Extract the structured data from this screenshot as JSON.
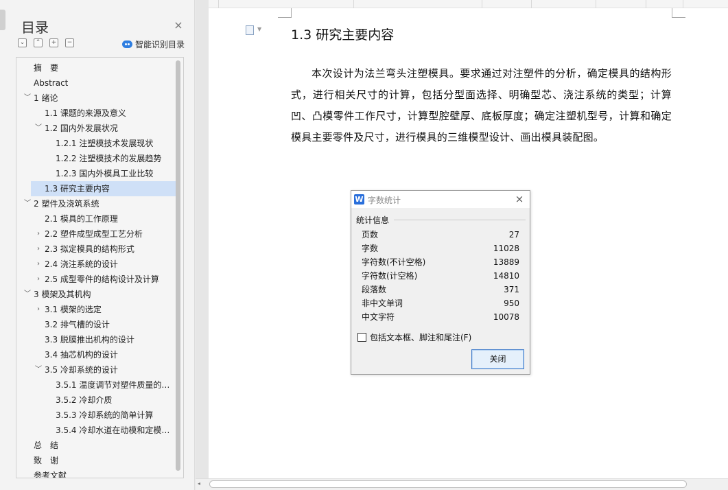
{
  "toc_panel": {
    "title": "目录",
    "close_glyph": "×",
    "tools": [
      "⌄",
      "⌃",
      "+",
      "−"
    ],
    "smart_identify_label": "智能识别目录",
    "items": [
      {
        "label": "摘　要",
        "level": 1,
        "caret": ""
      },
      {
        "label": "Abstract",
        "level": 1,
        "caret": ""
      },
      {
        "label": "1 绪论",
        "level": 1,
        "caret": "expanded"
      },
      {
        "label": "1.1 课题的来源及意义",
        "level": 2,
        "caret": ""
      },
      {
        "label": "1.2 国内外发展状况",
        "level": 2,
        "caret": "expanded"
      },
      {
        "label": "1.2.1 注塑模技术发展现状",
        "level": 3,
        "caret": ""
      },
      {
        "label": "1.2.2 注塑模技术的发展趋势",
        "level": 3,
        "caret": ""
      },
      {
        "label": "1.2.3 国内外模具工业比较",
        "level": 3,
        "caret": ""
      },
      {
        "label": "1.3 研究主要内容",
        "level": 2,
        "caret": "",
        "selected": true
      },
      {
        "label": "2 塑件及浇筑系统",
        "level": 1,
        "caret": "expanded"
      },
      {
        "label": "2.1 模具的工作原理",
        "level": 2,
        "caret": ""
      },
      {
        "label": "2.2 塑件成型成型工艺分析",
        "level": 2,
        "caret": "collapsed"
      },
      {
        "label": "2.3 拟定模具的结构形式",
        "level": 2,
        "caret": "collapsed"
      },
      {
        "label": "2.4 浇注系统的设计",
        "level": 2,
        "caret": "collapsed"
      },
      {
        "label": "2.5 成型零件的结构设计及计算",
        "level": 2,
        "caret": "collapsed"
      },
      {
        "label": "3 模架及其机构",
        "level": 1,
        "caret": "expanded"
      },
      {
        "label": "3.1 模架的选定",
        "level": 2,
        "caret": "collapsed"
      },
      {
        "label": "3.2 排气槽的设计",
        "level": 2,
        "caret": ""
      },
      {
        "label": "3.3 脱膜推出机构的设计",
        "level": 2,
        "caret": ""
      },
      {
        "label": "3.4 抽芯机构的设计",
        "level": 2,
        "caret": ""
      },
      {
        "label": "3.5 冷却系统的设计",
        "level": 2,
        "caret": "expanded"
      },
      {
        "label": "3.5.1 温度调节对塑件质量的 ...",
        "level": 3,
        "caret": ""
      },
      {
        "label": "3.5.2 冷却介质",
        "level": 3,
        "caret": ""
      },
      {
        "label": "3.5.3 冷却系统的简单计算",
        "level": 3,
        "caret": ""
      },
      {
        "label": "3.5.4 冷却水道在动模和定模 ...",
        "level": 3,
        "caret": ""
      },
      {
        "label": "总　结",
        "level": 1,
        "caret": ""
      },
      {
        "label": "致　谢",
        "level": 1,
        "caret": ""
      },
      {
        "label": "参考文献",
        "level": 1,
        "caret": ""
      }
    ]
  },
  "document": {
    "heading": "1.3 研究主要内容",
    "body": "本次设计为法兰弯头注塑模具。要求通过对注塑件的分析，确定模具的结构形式，进行相关尺寸的计算，包括分型面选择、明确型芯、浇注系统的类型；计算凹、凸模零件工作尺寸，计算型腔壁厚、底板厚度；确定注塑机型号，计算和确定模具主要零件及尺寸，进行模具的三维模型设计、画出模具装配图。"
  },
  "dialog": {
    "logo_glyph": "W",
    "title": "字数统计",
    "close_glyph": "×",
    "group_label": "统计信息",
    "stats": [
      {
        "label": "页数",
        "value": "27"
      },
      {
        "label": "字数",
        "value": "11028"
      },
      {
        "label": "字符数(不计空格)",
        "value": "13889"
      },
      {
        "label": "字符数(计空格)",
        "value": "14810"
      },
      {
        "label": "段落数",
        "value": "371"
      },
      {
        "label": "非中文单词",
        "value": "950"
      },
      {
        "label": "中文字符",
        "value": "10078"
      }
    ],
    "checkbox_label": "包括文本框、脚注和尾注(F)",
    "checkbox_checked": false,
    "close_button": "关闭"
  },
  "scrollbar": {
    "left_arrow": "◂"
  }
}
